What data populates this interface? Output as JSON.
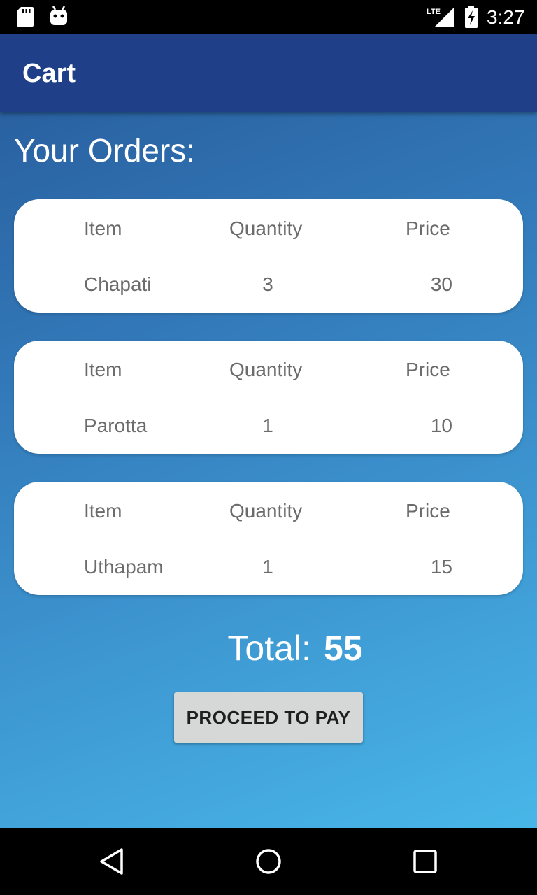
{
  "status_bar": {
    "time": "3:27",
    "network_label": "LTE",
    "icons": [
      "sd-card-icon",
      "android-icon",
      "signal-icon",
      "battery-charging-icon"
    ]
  },
  "toolbar": {
    "title": "Cart"
  },
  "orders": {
    "heading": "Your Orders:",
    "column_headers": {
      "item": "Item",
      "quantity": "Quantity",
      "price": "Price"
    },
    "items": [
      {
        "item": "Chapati",
        "quantity": "3",
        "price": "30"
      },
      {
        "item": "Parotta",
        "quantity": "1",
        "price": "10"
      },
      {
        "item": "Uthapam",
        "quantity": "1",
        "price": "15"
      }
    ]
  },
  "total": {
    "label": "Total:",
    "value": "55"
  },
  "actions": {
    "proceed_label": "PROCEED TO PAY"
  },
  "colors": {
    "toolbar": "#1f3f88",
    "background_start": "#275a9a",
    "background_end": "#48b6e8",
    "card": "#ffffff",
    "button": "#d6d7d7"
  },
  "nav_bar": {
    "icons": [
      "back-icon",
      "home-icon",
      "recent-apps-icon"
    ]
  }
}
